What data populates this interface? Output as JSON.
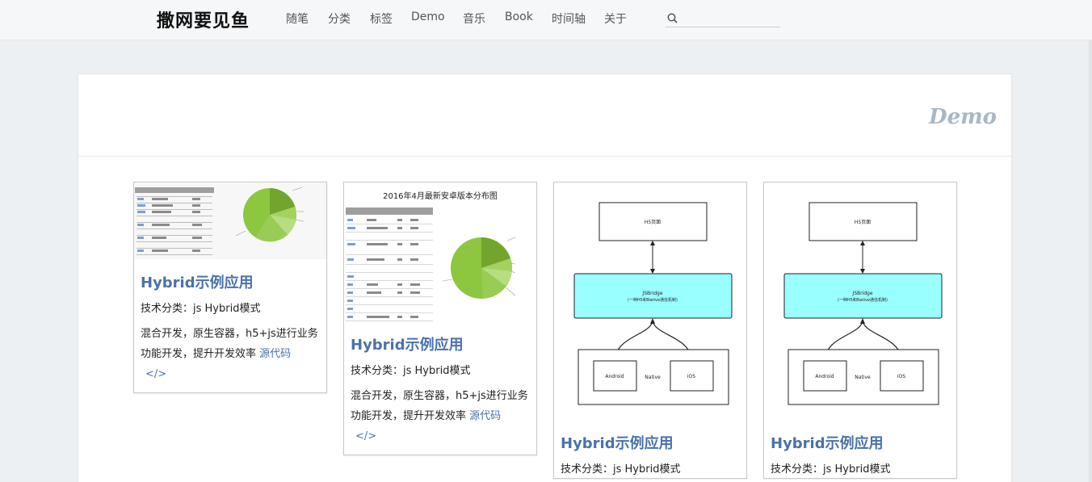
{
  "site": {
    "brand": "撒网要见鱼"
  },
  "nav": {
    "items": [
      {
        "label": "随笔"
      },
      {
        "label": "分类"
      },
      {
        "label": "标签"
      },
      {
        "label": "Demo"
      },
      {
        "label": "音乐"
      },
      {
        "label": "Book"
      },
      {
        "label": "时间轴"
      },
      {
        "label": "关于"
      }
    ],
    "search": {
      "icon": "search-icon",
      "placeholder": ""
    }
  },
  "page": {
    "title": "Demo"
  },
  "cards": [
    {
      "title": "Hybrid示例应用",
      "category": "技术分类：js Hybrid模式",
      "description": "混合开发，原生容器，h5+js进行业务功能开发，提升开发效率",
      "link_label": "源代码",
      "code_icon": "</>",
      "image": "android-distribution-chart"
    },
    {
      "title": "Hybrid示例应用",
      "category": "技术分类：js Hybrid模式",
      "description": "混合开发，原生容器，h5+js进行业务功能开发，提升开发效率",
      "link_label": "源代码",
      "code_icon": "</>",
      "image": "android-distribution-chart-titled",
      "image_title": "2016年4月最新安卓版本分布图"
    },
    {
      "title": "Hybrid示例应用",
      "category": "技术分类：js Hybrid模式",
      "image": "jsbridge-diagram",
      "diagram": {
        "top": "H5页面",
        "bridge": "JSBridge",
        "bridge_sub": "(一种H5和Native通信机制)",
        "left": "Android",
        "center": "Native",
        "right": "iOS"
      }
    },
    {
      "title": "Hybrid示例应用",
      "category": "技术分类：js Hybrid模式",
      "image": "jsbridge-diagram",
      "diagram": {
        "top": "H5页面",
        "bridge": "JSBridge",
        "bridge_sub": "(一种H5和Native通信机制)",
        "left": "Android",
        "center": "Native",
        "right": "iOS"
      }
    }
  ],
  "colors": {
    "accent": "#4a72aa",
    "page_title": "#a9b7c3",
    "pie_green": "#8dc63f",
    "bridge_fill": "#99ffff"
  }
}
